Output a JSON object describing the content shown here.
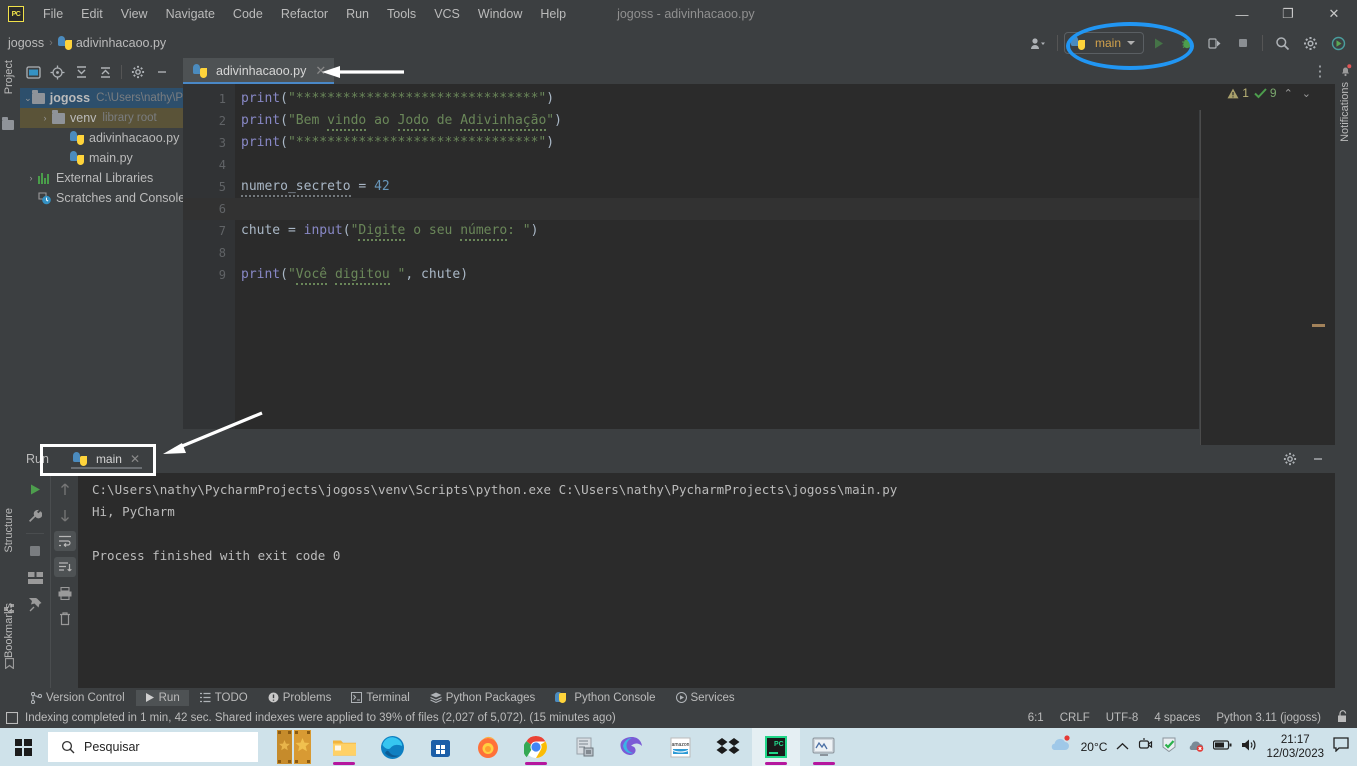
{
  "titlebar": {
    "logo": "PC",
    "menu": [
      "File",
      "Edit",
      "View",
      "Navigate",
      "Code",
      "Refactor",
      "Run",
      "Tools",
      "VCS",
      "Window",
      "Help"
    ],
    "window_title": "jogoss - adivinhacaoo.py",
    "minimize": "—",
    "maximize": "❐",
    "close": "✕"
  },
  "breadcrumb": {
    "project": "jogoss",
    "separator": "›",
    "file": "adivinhacaoo.py"
  },
  "toolbar": {
    "run_config": "main",
    "account_icon": "user-icon",
    "run_icon": "run-icon",
    "debug_icon": "debug-icon",
    "coverage_icon": "coverage-icon",
    "stop_icon": "stop-icon",
    "search_icon": "search-icon",
    "settings_icon": "gear-icon",
    "ai_icon": "ai-icon"
  },
  "project_panel": {
    "vertical_label": "Project",
    "toolbar_icons": [
      "select-opened-file-icon",
      "locate-icon",
      "expand-all-icon",
      "collapse-all-icon",
      "gear-icon",
      "minimize-icon"
    ],
    "tree": [
      {
        "label": "jogoss",
        "sub": "C:\\Users\\nathy\\P",
        "twisty": "⌄",
        "depth": 0,
        "kind": "folder",
        "state": "selected"
      },
      {
        "label": "venv",
        "sub": "library root",
        "twisty": "›",
        "depth": 1,
        "kind": "folder",
        "state": "highlight"
      },
      {
        "label": "adivinhacaoo.py",
        "sub": "",
        "twisty": "",
        "depth": 2,
        "kind": "python",
        "state": ""
      },
      {
        "label": "main.py",
        "sub": "",
        "twisty": "",
        "depth": 2,
        "kind": "python",
        "state": ""
      },
      {
        "label": "External Libraries",
        "sub": "",
        "twisty": "›",
        "depth": 0,
        "kind": "library",
        "state": ""
      },
      {
        "label": "Scratches and Consoles",
        "sub": "",
        "twisty": "",
        "depth": 1,
        "kind": "scratch",
        "state": ""
      }
    ]
  },
  "editor": {
    "tab_label": "adivinhacaoo.py",
    "tab_close": "✕",
    "more_icon": "⋮",
    "line_numbers": [
      "1",
      "2",
      "3",
      "4",
      "5",
      "6",
      "7",
      "8",
      "9"
    ],
    "lines": [
      {
        "n": 1,
        "tokens": [
          {
            "t": "print",
            "c": "k-fn"
          },
          {
            "t": "(",
            "c": "k-op"
          },
          {
            "t": "\"*******************************\"",
            "c": "k-str"
          },
          {
            "t": ")",
            "c": "k-op"
          }
        ]
      },
      {
        "n": 2,
        "tokens": [
          {
            "t": "print",
            "c": "k-fn"
          },
          {
            "t": "(",
            "c": "k-op"
          },
          {
            "t": "\"Bem ",
            "c": "k-str"
          },
          {
            "t": "vindo",
            "c": "k-str typo"
          },
          {
            "t": " ao ",
            "c": "k-str"
          },
          {
            "t": "Jodo",
            "c": "k-str typo"
          },
          {
            "t": " de ",
            "c": "k-str"
          },
          {
            "t": "Adivinhação",
            "c": "k-str typo"
          },
          {
            "t": "\"",
            "c": "k-str"
          },
          {
            "t": ")",
            "c": "k-op"
          }
        ]
      },
      {
        "n": 3,
        "tokens": [
          {
            "t": "print",
            "c": "k-fn"
          },
          {
            "t": "(",
            "c": "k-op"
          },
          {
            "t": "\"*******************************\"",
            "c": "k-str"
          },
          {
            "t": ")",
            "c": "k-op"
          }
        ]
      },
      {
        "n": 4,
        "tokens": []
      },
      {
        "n": 5,
        "tokens": [
          {
            "t": "numero_secreto",
            "c": "k-var typo2"
          },
          {
            "t": " = ",
            "c": "k-op"
          },
          {
            "t": "42",
            "c": "k-num"
          }
        ]
      },
      {
        "n": 6,
        "tokens": [],
        "caret": true
      },
      {
        "n": 7,
        "tokens": [
          {
            "t": "chute",
            "c": "k-var"
          },
          {
            "t": " = ",
            "c": "k-op"
          },
          {
            "t": "input",
            "c": "k-fn"
          },
          {
            "t": "(",
            "c": "k-op"
          },
          {
            "t": "\"",
            "c": "k-str"
          },
          {
            "t": "Digite",
            "c": "k-str typo"
          },
          {
            "t": " o seu ",
            "c": "k-str"
          },
          {
            "t": "número",
            "c": "k-str typo"
          },
          {
            "t": ": \"",
            "c": "k-str"
          },
          {
            "t": ")",
            "c": "k-op"
          }
        ]
      },
      {
        "n": 8,
        "tokens": []
      },
      {
        "n": 9,
        "tokens": [
          {
            "t": "print",
            "c": "k-fn"
          },
          {
            "t": "(",
            "c": "k-op"
          },
          {
            "t": "\"",
            "c": "k-str"
          },
          {
            "t": "Você",
            "c": "k-str typo"
          },
          {
            "t": " ",
            "c": "k-str"
          },
          {
            "t": "digitou",
            "c": "k-str typo"
          },
          {
            "t": " \"",
            "c": "k-str"
          },
          {
            "t": ", ",
            "c": "k-op"
          },
          {
            "t": "chute",
            "c": "k-var"
          },
          {
            "t": ")",
            "c": "k-op"
          }
        ]
      }
    ],
    "inspection": {
      "warning_count": "1",
      "ok_count": "9",
      "prev_arrow": "⌃",
      "next_arrow": "⌄"
    }
  },
  "right_strip": {
    "label": "Notifications",
    "icon": "bell-icon"
  },
  "left_strip": {
    "labels": [
      "Structure",
      "Bookmarks"
    ]
  },
  "run_panel": {
    "title": "Run",
    "tab_label": "main",
    "tab_close": "✕",
    "sidebar_icons": [
      "rerun-icon",
      "wrench-icon",
      "stop-icon",
      "layout-icon",
      "pin-icon"
    ],
    "sidebar2_icons": [
      "up-arrow-icon",
      "down-arrow-icon",
      "soft-wrap-icon",
      "scroll-to-end-icon",
      "print-icon",
      "trash-icon"
    ],
    "header_icons": [
      "gear-icon",
      "minimize-icon"
    ],
    "console_lines": [
      "C:\\Users\\nathy\\PycharmProjects\\jogoss\\venv\\Scripts\\python.exe C:\\Users\\nathy\\PycharmProjects\\jogoss\\main.py",
      "Hi, PyCharm",
      "",
      "Process finished with exit code 0"
    ]
  },
  "toolwindow_bar": [
    {
      "label": "Version Control",
      "icon": "branch-icon",
      "active": false
    },
    {
      "label": "Run",
      "icon": "run-icon",
      "active": true
    },
    {
      "label": "TODO",
      "icon": "list-icon",
      "active": false
    },
    {
      "label": "Problems",
      "icon": "alert-icon",
      "active": false
    },
    {
      "label": "Terminal",
      "icon": "terminal-icon",
      "active": false
    },
    {
      "label": "Python Packages",
      "icon": "packages-icon",
      "active": false
    },
    {
      "label": "Python Console",
      "icon": "python-icon",
      "active": false
    },
    {
      "label": "Services",
      "icon": "services-icon",
      "active": false
    }
  ],
  "status_bar": {
    "indexing_icon": "progress-icon",
    "message": "Indexing completed in 1 min, 42 sec. Shared indexes were applied to 39% of files (2,027 of 5,072). (15 minutes ago)",
    "caret_position": "6:1",
    "line_separator": "CRLF",
    "encoding": "UTF-8",
    "indent": "4 spaces",
    "interpreter": "Python 3.11 (jogoss)",
    "lock_icon": "unlock-icon"
  },
  "taskbar": {
    "start_icon": "windows-icon",
    "search_placeholder": "Pesquisar",
    "search_icon": "search-icon",
    "apps": [
      {
        "name": "file-explorer-icon"
      },
      {
        "name": "edge-icon"
      },
      {
        "name": "microsoft-store-icon"
      },
      {
        "name": "firefox-icon"
      },
      {
        "name": "chrome-icon"
      },
      {
        "name": "scanner-icon"
      },
      {
        "name": "edge-dev-icon"
      },
      {
        "name": "amazon-icon"
      },
      {
        "name": "dropbox-icon"
      },
      {
        "name": "pycharm-icon"
      },
      {
        "name": "monitor-icon"
      }
    ],
    "weather_temp": "20°C",
    "weather_icon": "cloud-icon",
    "tray_icons": [
      "chevron-up-icon",
      "camera-icon",
      "shield-icon",
      "onedrive-icon",
      "battery-icon",
      "volume-icon"
    ],
    "time": "21:17",
    "date": "12/03/2023",
    "notification_icon": "notification-icon"
  }
}
